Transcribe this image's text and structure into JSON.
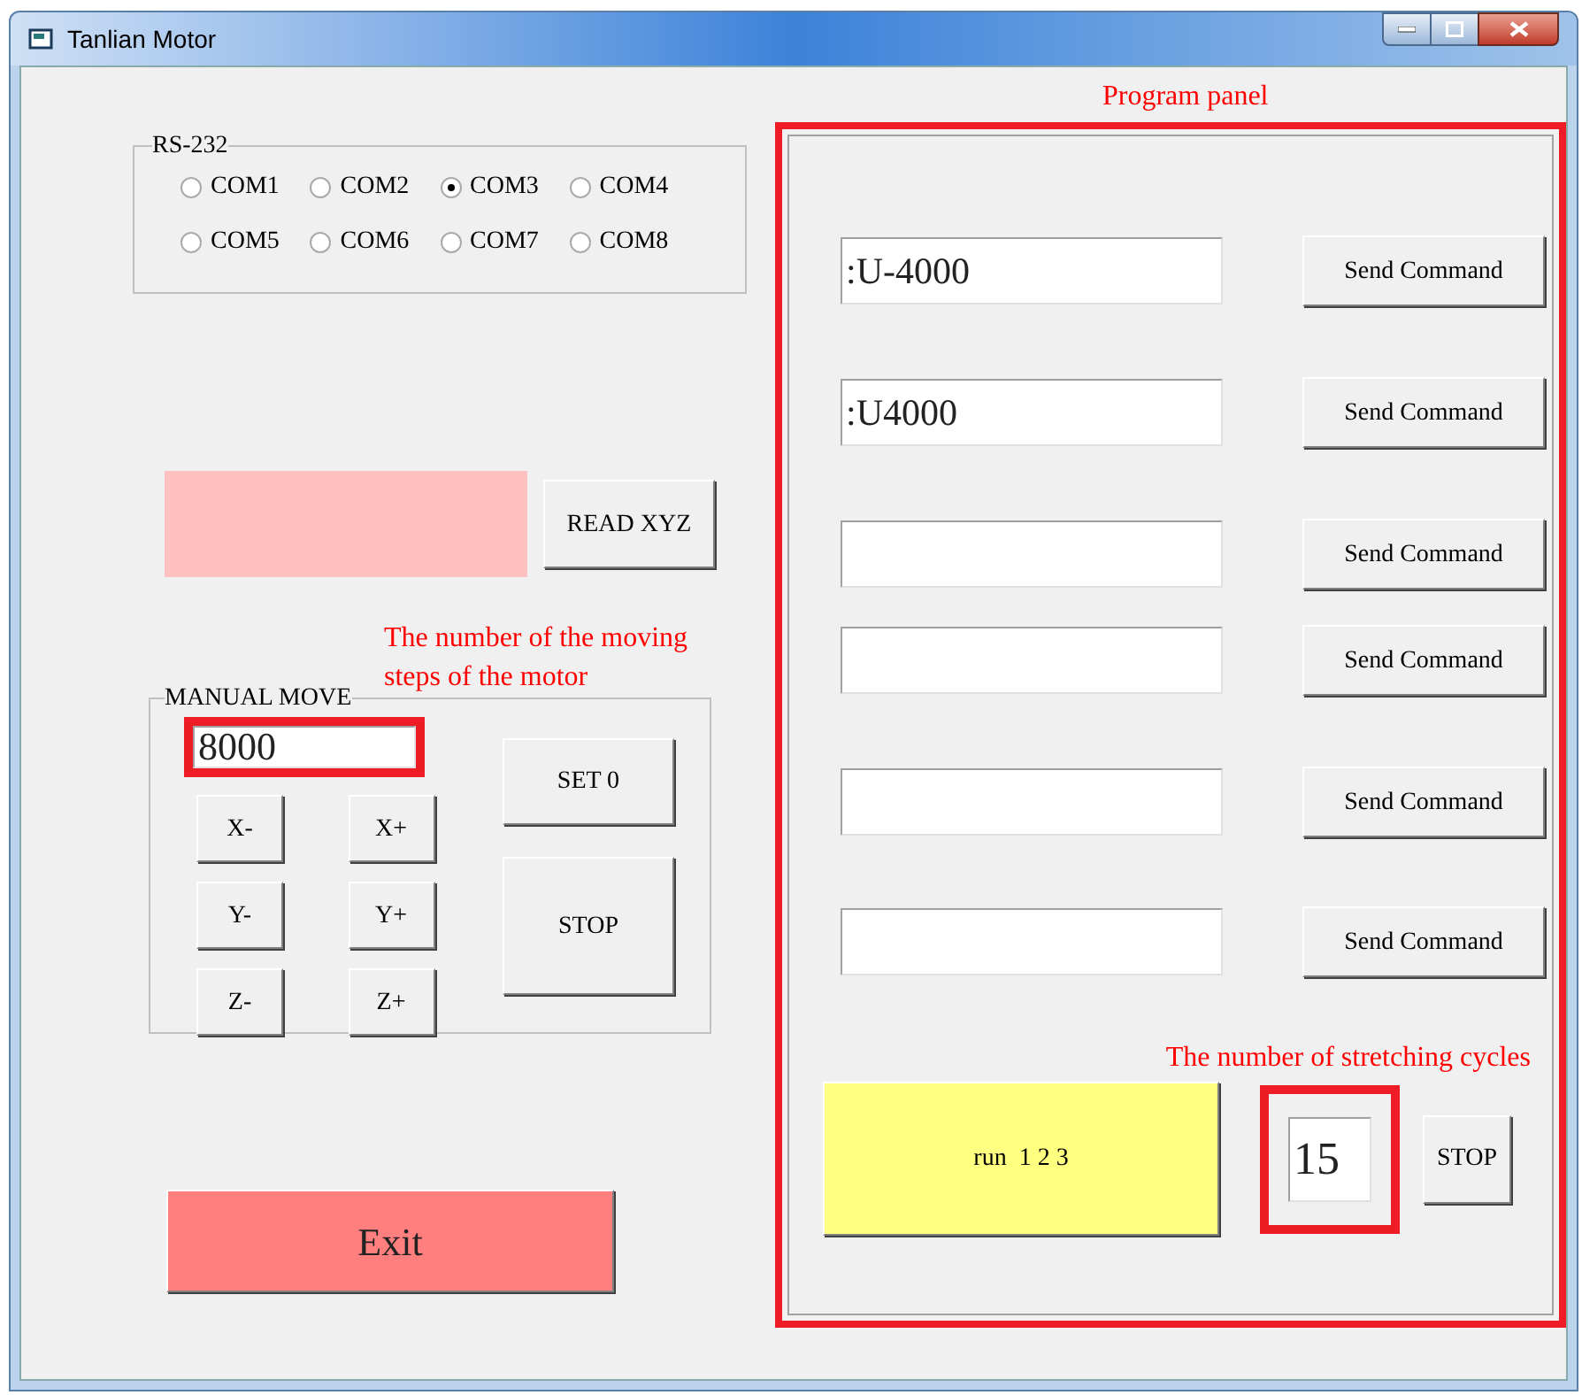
{
  "window": {
    "title": "Tanlian Motor"
  },
  "rs232": {
    "label": "RS-232",
    "ports": [
      {
        "label": "COM1",
        "selected": false
      },
      {
        "label": "COM2",
        "selected": false
      },
      {
        "label": "COM3",
        "selected": true
      },
      {
        "label": "COM4",
        "selected": false
      },
      {
        "label": "COM5",
        "selected": false
      },
      {
        "label": "COM6",
        "selected": false
      },
      {
        "label": "COM7",
        "selected": false
      },
      {
        "label": "COM8",
        "selected": false
      }
    ]
  },
  "position": {
    "read_button": "READ XYZ"
  },
  "manual_move": {
    "annotation": "The number of the moving steps of the motor",
    "label": "MANUAL MOVE",
    "steps": "8000",
    "jog_buttons": [
      "X-",
      "X+",
      "Y-",
      "Y+",
      "Z-",
      "Z+"
    ],
    "set_zero_button": "SET 0",
    "stop_button": "STOP"
  },
  "exit_button": "Exit",
  "program_panel": {
    "label": "Program panel",
    "commands": [
      {
        "value": ":U-4000",
        "button": "Send Command"
      },
      {
        "value": ":U4000",
        "button": "Send Command"
      },
      {
        "button": "Send Command"
      },
      {
        "button": "Send Command"
      },
      {
        "button": "Send Command"
      },
      {
        "button": "Send Command"
      }
    ],
    "annotation": "The number of stretching cycles",
    "run_button": "run  1 2 3",
    "cycles": "15",
    "stop_button": "STOP"
  }
}
